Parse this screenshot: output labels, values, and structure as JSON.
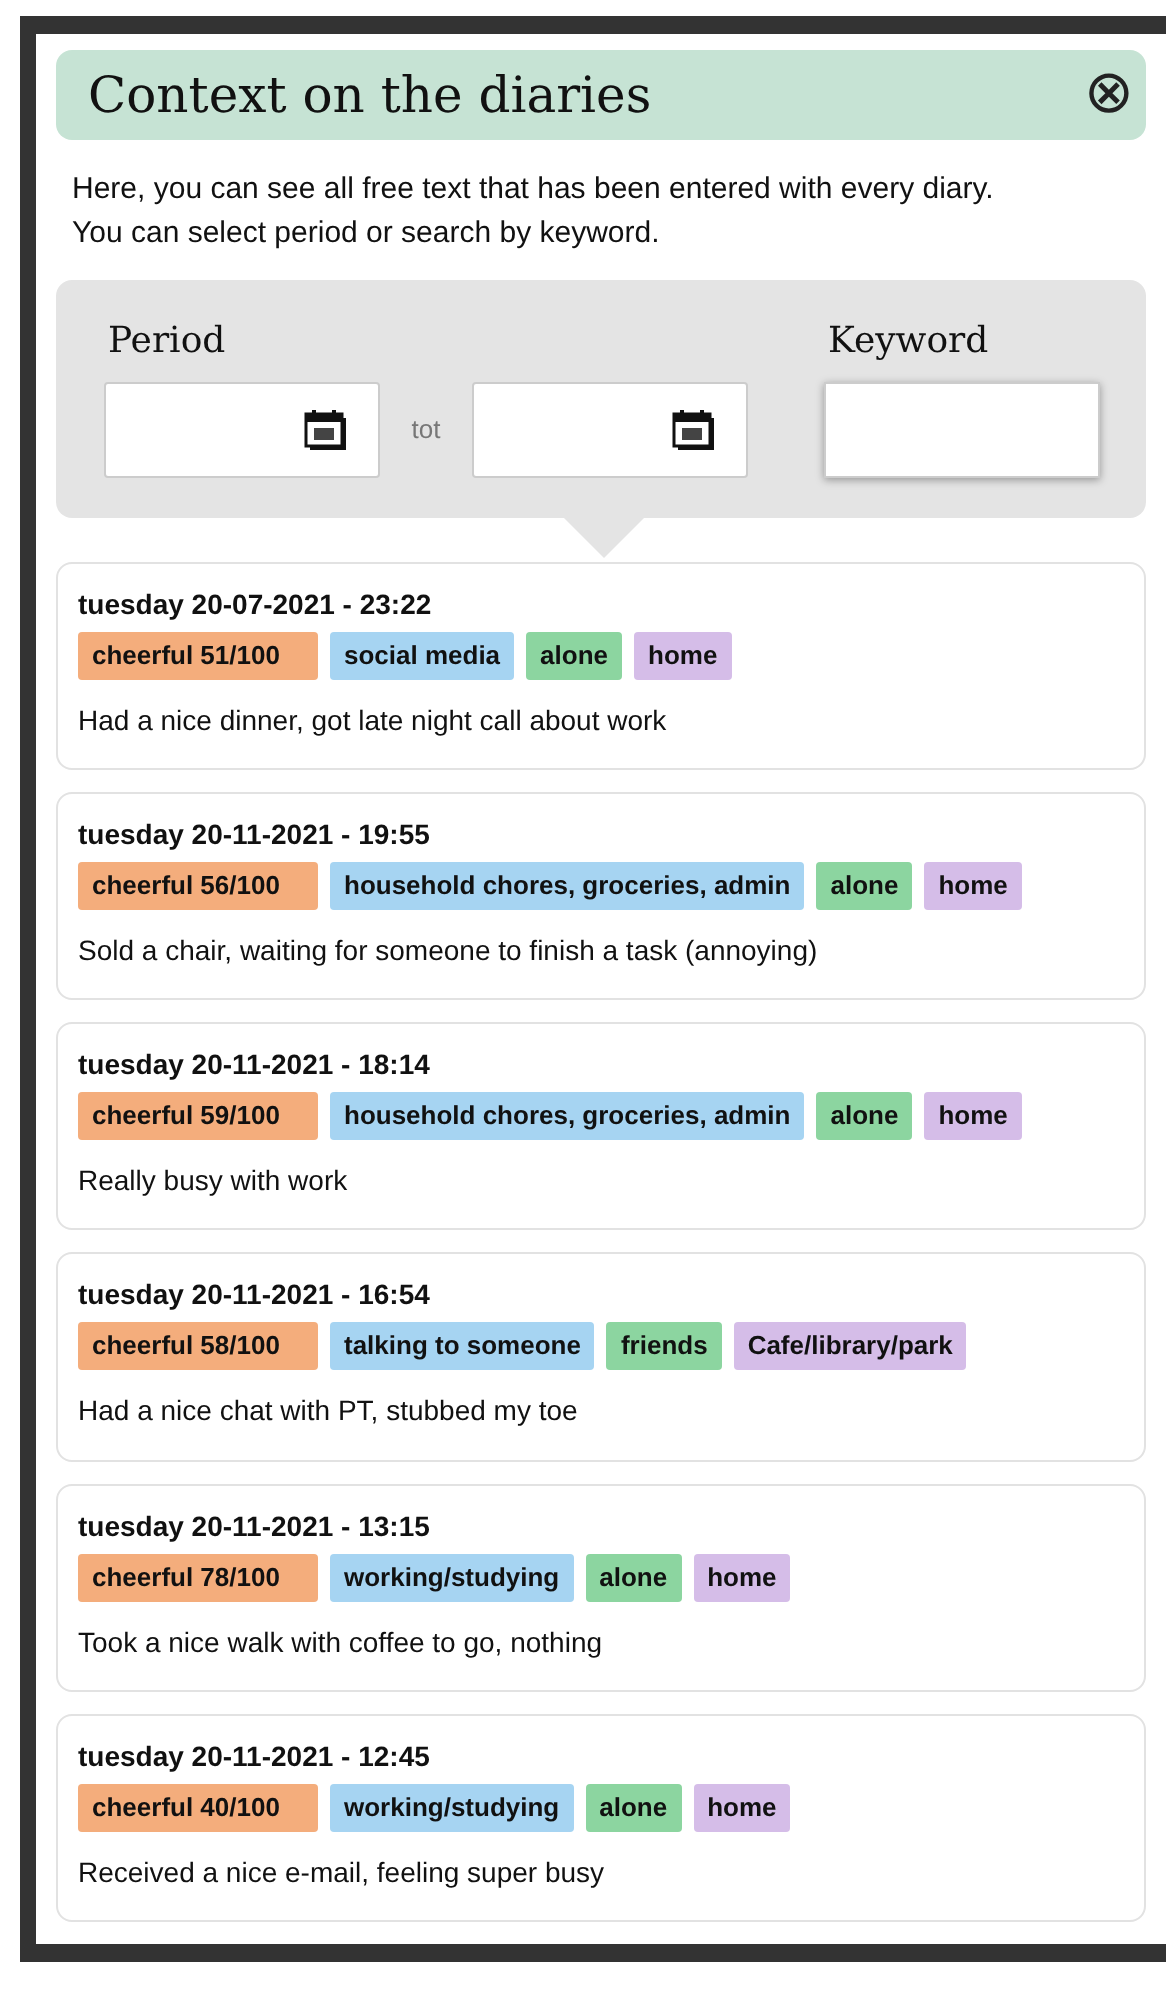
{
  "dialog": {
    "title": "Context on the diaries",
    "close_label": "⊗",
    "intro": "Here, you can see all free text that has been entered with every diary.\nYou can select period or search by keyword."
  },
  "filters": {
    "period_label": "Period",
    "range_separator": "tot",
    "keyword_label": "Keyword"
  },
  "entries": [
    {
      "date": "tuesday 20-07-2021 - 23:22",
      "tags": [
        {
          "kind": "mood",
          "label": "cheerful 51/100"
        },
        {
          "kind": "activity",
          "label": "social media"
        },
        {
          "kind": "company",
          "label": "alone"
        },
        {
          "kind": "place",
          "label": "home"
        }
      ],
      "note": "Had a nice dinner, got late night call about work"
    },
    {
      "date": "tuesday 20-11-2021 - 19:55",
      "tags": [
        {
          "kind": "mood",
          "label": "cheerful 56/100"
        },
        {
          "kind": "activity",
          "label": "household chores, groceries, admin"
        },
        {
          "kind": "company",
          "label": "alone"
        },
        {
          "kind": "place",
          "label": "home"
        }
      ],
      "note": "Sold a chair, waiting for someone to finish a task (annoying)"
    },
    {
      "date": "tuesday 20-11-2021 - 18:14",
      "tags": [
        {
          "kind": "mood",
          "label": "cheerful 59/100"
        },
        {
          "kind": "activity",
          "label": "household chores, groceries, admin"
        },
        {
          "kind": "company",
          "label": "alone"
        },
        {
          "kind": "place",
          "label": "home"
        }
      ],
      "note": "Really busy with work"
    },
    {
      "date": "tuesday 20-11-2021 - 16:54",
      "tags": [
        {
          "kind": "mood",
          "label": "cheerful 58/100"
        },
        {
          "kind": "activity",
          "label": "talking to someone"
        },
        {
          "kind": "company",
          "label": "friends"
        },
        {
          "kind": "place",
          "label": "Cafe/library/park"
        }
      ],
      "note": "Had a nice chat with PT, stubbed my toe"
    },
    {
      "date": "tuesday 20-11-2021 - 13:15",
      "tags": [
        {
          "kind": "mood",
          "label": "cheerful 78/100"
        },
        {
          "kind": "activity",
          "label": "working/studying"
        },
        {
          "kind": "company",
          "label": "alone"
        },
        {
          "kind": "place",
          "label": "home"
        }
      ],
      "note": "Took a nice walk with coffee to go, nothing"
    },
    {
      "date": "tuesday 20-11-2021 - 12:45",
      "tags": [
        {
          "kind": "mood",
          "label": "cheerful 40/100"
        },
        {
          "kind": "activity",
          "label": "working/studying"
        },
        {
          "kind": "company",
          "label": "alone"
        },
        {
          "kind": "place",
          "label": "home"
        }
      ],
      "note": "Received a nice e-mail, feeling super busy"
    }
  ]
}
